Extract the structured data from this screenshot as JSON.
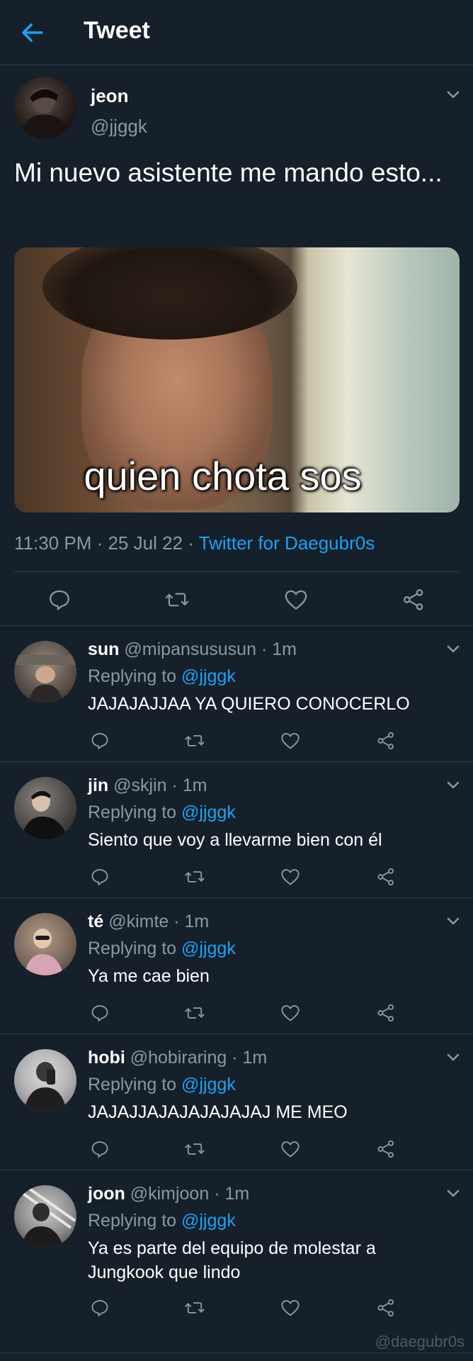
{
  "header": {
    "title": "Tweet"
  },
  "tweet": {
    "name": "jeon",
    "handle": "@jjggk",
    "text": "Mi nuevo asistente me mando esto...",
    "media_caption": "quien chota sos",
    "time": "11:30 PM",
    "date": "25 Jul 22",
    "source": "Twitter for Daegubr0s",
    "sep": " · "
  },
  "replies": [
    {
      "name": "sun",
      "handle": "@mipansususun",
      "time": "· 1m",
      "replying_prefix": "Replying to ",
      "replying_to": "@jjggk",
      "text": "JAJAJAJJAA YA QUIERO CONOCERLO"
    },
    {
      "name": "jin",
      "handle": "@skjin",
      "time": "· 1m",
      "replying_prefix": "Replying to ",
      "replying_to": "@jjggk",
      "text": "Siento que voy a llevarme bien con él"
    },
    {
      "name": "té",
      "handle": "@kimte",
      "time": "· 1m",
      "replying_prefix": "Replying to ",
      "replying_to": "@jjggk",
      "text": "Ya me cae bien"
    },
    {
      "name": "hobi",
      "handle": "@hobiraring",
      "time": "· 1m",
      "replying_prefix": "Replying to ",
      "replying_to": "@jjggk",
      "text": "JAJAJJAJAJAJAJAJAJ ME MEO"
    },
    {
      "name": "joon",
      "handle": "@kimjoon",
      "time": "· 1m",
      "replying_prefix": "Replying to ",
      "replying_to": "@jjggk",
      "text": "Ya es parte del equipo de molestar a Jungkook que lindo"
    }
  ],
  "watermark": "@daegubr0s",
  "colors": {
    "background": "#15202b",
    "accent": "#1da1f2",
    "secondary_text": "#8899a6",
    "divider": "#2f3d4b"
  },
  "icons": [
    "back-arrow-icon",
    "chevron-down-icon",
    "reply-icon",
    "retweet-icon",
    "like-icon",
    "share-icon"
  ]
}
